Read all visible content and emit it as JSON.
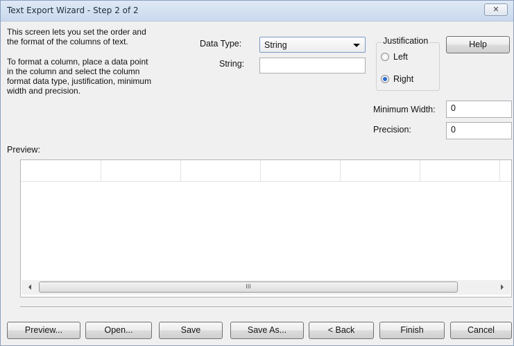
{
  "window": {
    "title": "Text Export Wizard - Step 2 of 2",
    "close_glyph": "✕"
  },
  "instructions": {
    "line1": "This screen lets you set the order and",
    "line2": "the format of the columns of text.",
    "line3": "To format a column, place a data point",
    "line4": "in the column and select the column",
    "line5": "format data type, justification, minimum",
    "line6": "width and precision."
  },
  "data_type": {
    "label": "Data Type:",
    "selected": "String"
  },
  "string_field": {
    "label": "String:",
    "value": ""
  },
  "justification": {
    "title": "Justification",
    "options": [
      {
        "label": "Left",
        "checked": false
      },
      {
        "label": "Right",
        "checked": true
      }
    ]
  },
  "help_button": "Help",
  "minimum_width": {
    "label": "Minimum Width:",
    "value": "0"
  },
  "precision": {
    "label": "Precision:",
    "value": "0"
  },
  "preview": {
    "label": "Preview:",
    "scroll_thumb_glyph": "III"
  },
  "buttons": {
    "preview": "Preview...",
    "open": "Open...",
    "save": "Save",
    "save_as": "Save As...",
    "back": "< Back",
    "finish": "Finish",
    "cancel": "Cancel"
  },
  "icons": {
    "close": "close-icon",
    "dropdown": "chevron-down-icon",
    "scroll_left": "arrow-left-icon",
    "scroll_right": "arrow-right-icon"
  }
}
